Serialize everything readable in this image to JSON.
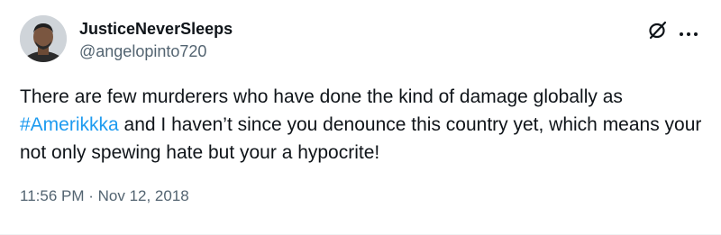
{
  "tweet": {
    "author": {
      "display_name": "JusticeNeverSleeps",
      "handle": "@angelopinto720"
    },
    "text": {
      "part1": "There are few murderers who have done the kind of damage globally as ",
      "hashtag": "#Amerikkka",
      "part2": " and I haven’t since you denounce this country yet, which means your not only spewing hate but your a hypocrite!"
    },
    "time": "11:56 PM",
    "separator": " · ",
    "date": "Nov 12, 2018"
  },
  "icons": {
    "grok": "grok-icon",
    "more": "more-icon"
  },
  "colors": {
    "link": "#1d9bf0",
    "secondary_text": "#536471",
    "primary_text": "#0f1419",
    "divider": "#eff3f4"
  }
}
